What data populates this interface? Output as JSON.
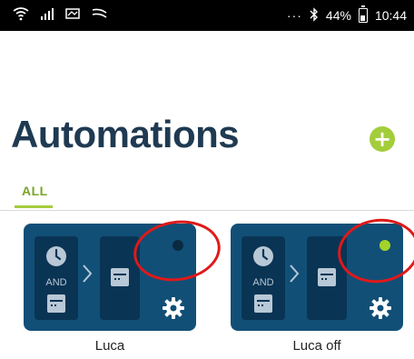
{
  "status_bar": {
    "dots": "···",
    "battery_percent": "44%",
    "time": "10:44",
    "icons": [
      "wifi-icon",
      "signal-icon",
      "message-icon",
      "data-icon",
      "bluetooth-icon",
      "battery-icon"
    ]
  },
  "header": {
    "title": "Automations",
    "add_icon": "plus-icon",
    "accent_color": "#a3cd3b",
    "title_color": "#1f3a52"
  },
  "tabs": [
    {
      "label": "ALL",
      "selected": true
    }
  ],
  "automations": [
    {
      "name": "Luca",
      "condition": "AND",
      "status_dot": "off"
    },
    {
      "name": "Luca off",
      "condition": "AND",
      "status_dot": "on"
    }
  ],
  "colors": {
    "card": "#114f77",
    "card_column": "#0a3454",
    "dot_on": "#a3d32b",
    "dot_off": "#0a2a42",
    "annotation": "#e01919"
  }
}
